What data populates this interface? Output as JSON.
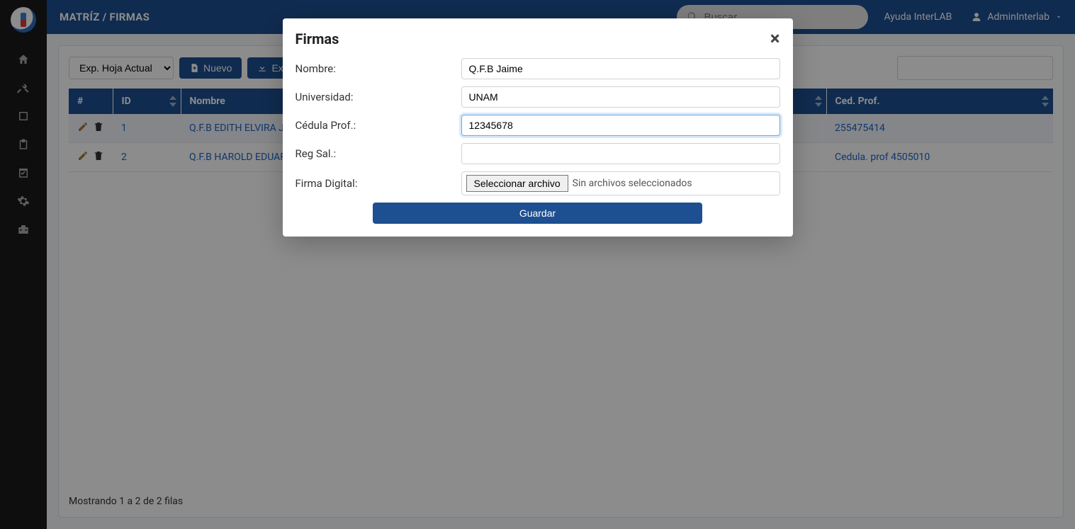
{
  "header": {
    "title": "MATRÍZ / FIRMAS",
    "search_placeholder": "Buscar...",
    "help_label": "Ayuda InterLAB",
    "user_name": "AdminInterlab"
  },
  "toolbar": {
    "export_select": "Exp. Hoja Actual",
    "new_label": "Nuevo",
    "export_label": "Exp"
  },
  "table": {
    "headers": {
      "num": "#",
      "id": "ID",
      "nombre": "Nombre",
      "ced": "Ced. Prof."
    },
    "rows": [
      {
        "id": "1",
        "nombre": "Q.F.B EDITH ELVIRA JU",
        "ced": "255475414"
      },
      {
        "id": "2",
        "nombre": "Q.F.B HAROLD EDUAR",
        "ced": "Cedula. prof 4505010"
      }
    ],
    "footer": "Mostrando 1 a 2 de 2 filas"
  },
  "modal": {
    "title": "Firmas",
    "labels": {
      "nombre": "Nombre:",
      "universidad": "Universidad:",
      "cedula": "Cédula Prof.:",
      "regsal": "Reg Sal.:",
      "firma": "Firma Digital:"
    },
    "values": {
      "nombre": "Q.F.B Jaime",
      "universidad": "UNAM",
      "cedula": "12345678",
      "regsal": ""
    },
    "file_button": "Seleccionar archivo",
    "file_status": "Sin archivos seleccionados",
    "save_label": "Guardar"
  }
}
